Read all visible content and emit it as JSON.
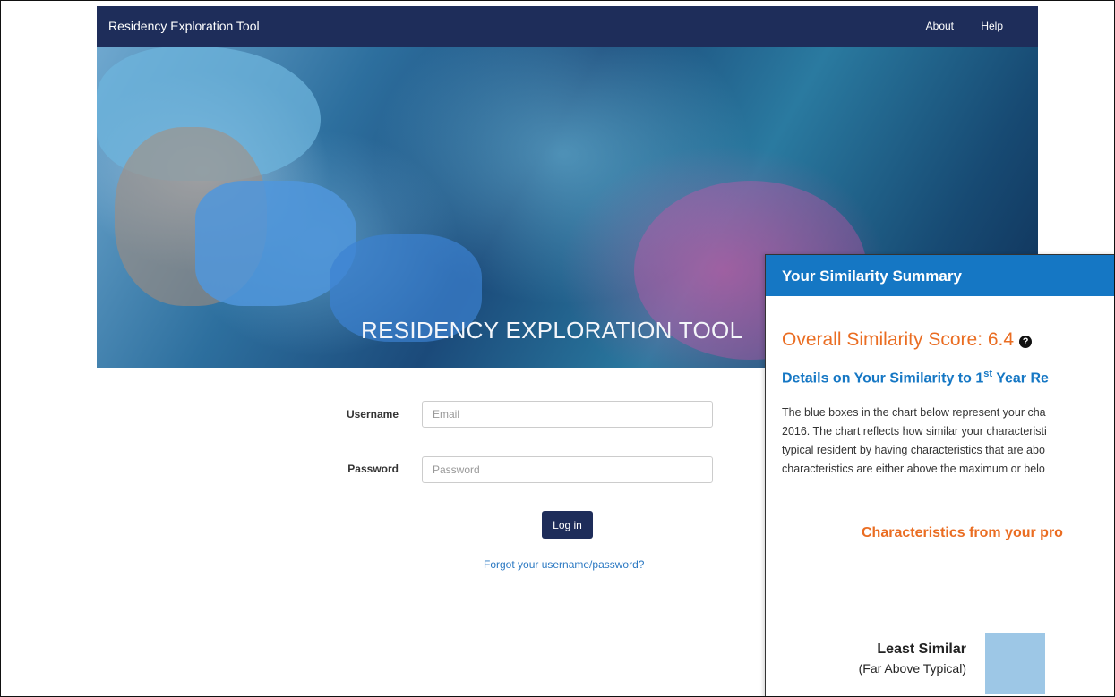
{
  "navbar": {
    "brand": "Residency Exploration Tool",
    "links": [
      "About",
      "Help"
    ]
  },
  "hero": {
    "title": "RESIDENCY EXPLORATION TOOL"
  },
  "login": {
    "username_label": "Username",
    "username_placeholder": "Email",
    "password_label": "Password",
    "password_placeholder": "Password",
    "submit_label": "Log in",
    "forgot_link": "Forgot your username/password?"
  },
  "summary": {
    "header": "Your Similarity Summary",
    "score_label": "Overall Similarity Score: 6.4",
    "help_icon_glyph": "?",
    "details_prefix": "Details on Your Similarity to 1",
    "details_sup": "st",
    "details_suffix": " Year Re",
    "description_lines": [
      "The blue boxes in the chart below represent your cha",
      "2016. The chart reflects how similar your characteristi",
      "typical resident by having characteristics that are abo",
      "characteristics are either above the maximum or belo"
    ],
    "characteristics_heading": "Characteristics from your pro",
    "least_similar_label": "Least Similar",
    "least_similar_sub": "(Far Above Typical)"
  },
  "colors": {
    "navbar": "#1e2d5a",
    "summary_header": "#1577c4",
    "accent_orange": "#ea6d22",
    "link_blue": "#2a78c2",
    "chart_box": "#9dc7e6"
  }
}
